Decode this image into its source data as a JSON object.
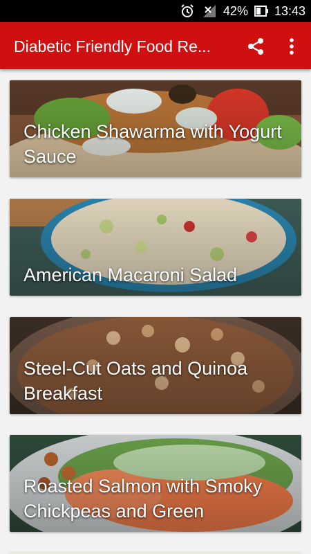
{
  "status_bar": {
    "battery_percent": "42%",
    "time": "13:43",
    "icons": [
      "alarm-icon",
      "no-signal-icon",
      "battery-icon"
    ]
  },
  "toolbar": {
    "title": "Diabetic Friendly Food Re...",
    "actions": [
      "share-icon",
      "overflow-menu-icon"
    ],
    "color": "#d01010"
  },
  "recipes": [
    {
      "title": "Chicken Shawarma with Yogurt Sauce"
    },
    {
      "title": "American Macaroni Salad"
    },
    {
      "title": "Steel-Cut Oats and Quinoa Breakfast"
    },
    {
      "title": "Roasted Salmon with Smoky Chickpeas and Green"
    }
  ]
}
